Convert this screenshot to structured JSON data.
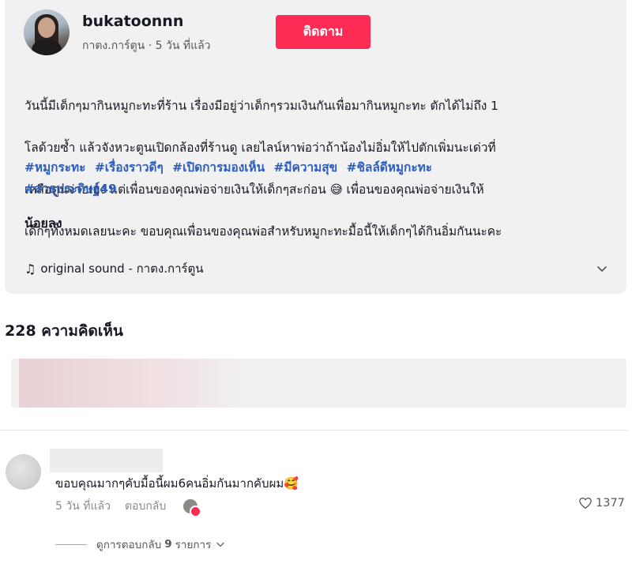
{
  "post": {
    "username": "bukatoonnn",
    "display_name": "กาตง.การ์ตูน",
    "time_ago": "5 วัน ที่แล้ว",
    "follow_label": "ติดตาม",
    "caption_lines": [
      "วันนี้มีเด็กๆมากินหมูกะทะที่ร้าน เรื่องมีอยู่ว่าเด็กๆรวมเงินกันเพื่อมากินหมูกะทะ ตักได้ไม่ถึง 1",
      "โลด้วยซ้ำ แล้วจังหวะตูนเปิดกล้องที่ร้านดู เลยไลน์หาพ่อว่าถ้าน้องไม่อิ่มให้ไปตักเพิ่มนะเด่วที่",
      "เหลือตูนจ่ายเอง แต่เพื่อนของคุณพ่อจ่ายเงินให้เด็กๆสะก่อน 😅  เพื่อนของคุณพ่อจ่ายเงินให้",
      "เด็กๆทั้งหมดเลยนะคะ ขอบคุณเพื่อนของคุณพ่อสำหรับหมูกะทะมื้อนี้ให้เด็กๆได้กินอิ่มกันนะคะ"
    ],
    "hashtags": [
      "#หมูกระทะ",
      "#เรื่องราวดีๆ",
      "#เปิดการมองเห็น",
      "#มีความสุข",
      "#ชิลล์ดีหมูกะทะ",
      "#สาธุประดิษฐ์49"
    ],
    "less_label": "น้อยลง",
    "music_icon": "music-note-icon",
    "music_label": "original sound - กาตง.การ์ตูน",
    "accent_color": "#fe2c55",
    "hashtag_color": "#2b5db9"
  },
  "comments": {
    "count_label": "228 ความคิดเห็น",
    "items": [
      {
        "text": "ขอบคุณมากๆคับมื้อนี้ผม6คนอิ่มกันมากคับผม🥰",
        "time_ago": "5 วัน ที่แล้ว",
        "reply_label": "ตอบกลับ",
        "likes": "1377",
        "view_replies_prefix": "ดูการตอบกลับ",
        "view_replies_count": "9",
        "view_replies_suffix": "รายการ"
      }
    ]
  }
}
